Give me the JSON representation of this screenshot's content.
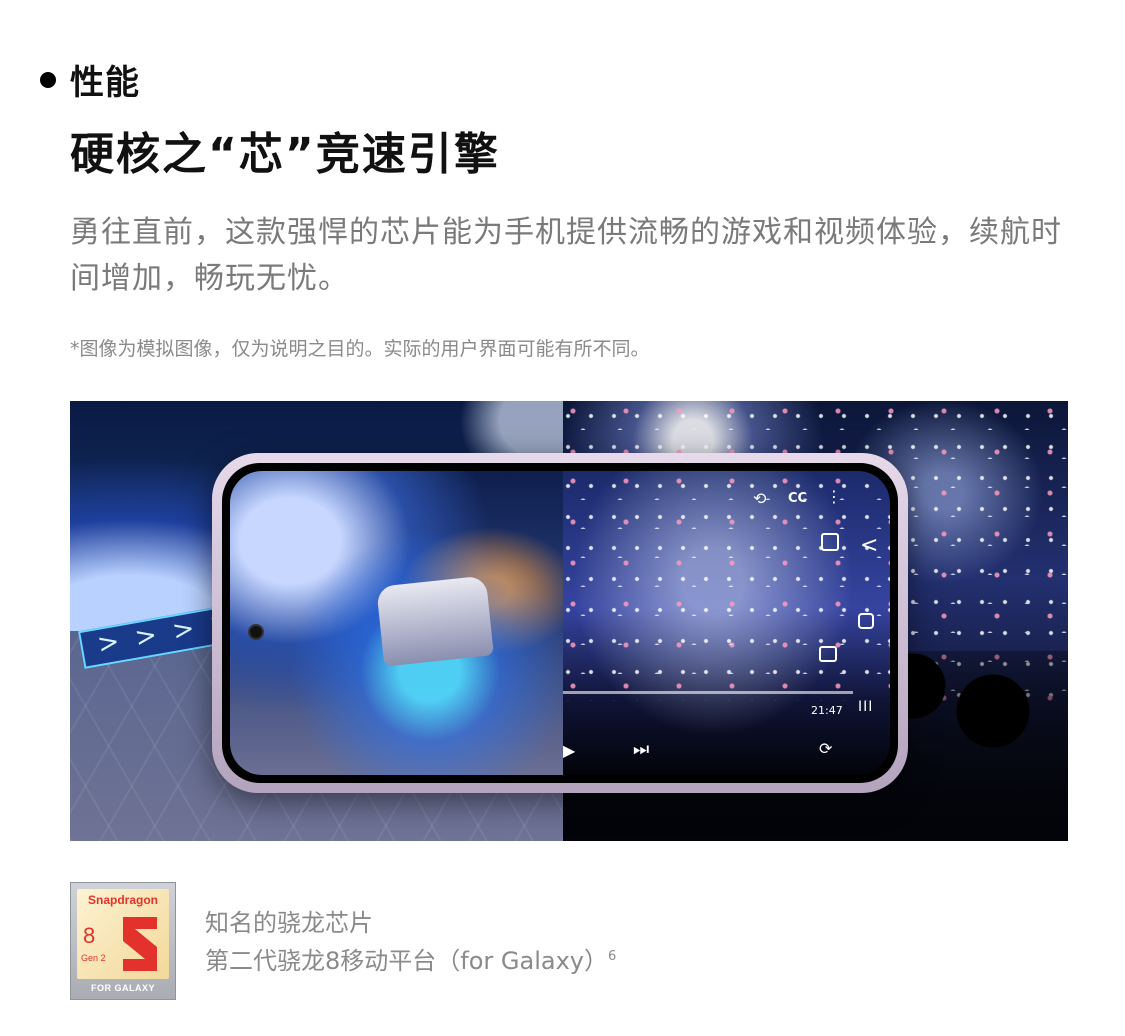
{
  "section": {
    "label": "性能"
  },
  "headline": "硬核之“芯”竞速引擎",
  "body": "勇往直前，这款强悍的芯片能为手机提供流畅的游戏和视频体验，续航时间增加，畅玩无忧。",
  "disclaimer": "*图像为模拟图像，仅为说明之目的。实际的用户界面可能有所不同。",
  "hero": {
    "left_scene": "racing-game",
    "right_scene": "concert-video",
    "game": {
      "track_chevrons": "> > > >"
    },
    "video": {
      "time": "21:47",
      "cc_label": "CC",
      "icons": [
        "rotate-icon",
        "cc-icon",
        "more-vert-icon",
        "pip-icon",
        "screenshot-icon",
        "play-icon",
        "fast-forward-icon",
        "rotate-lock-icon"
      ]
    },
    "navbar": {
      "back": "<",
      "recent": "III"
    }
  },
  "chip": {
    "badge": {
      "brand": "Snapdragon",
      "number": "8",
      "gen": "Gen 2",
      "footer": "FOR GALAXY"
    },
    "title": "知名的骁龙芯片",
    "subtitle": "第二代骁龙8移动平台（for Galaxy）",
    "footnote": "6",
    "colors": {
      "brand_red": "#e3322b",
      "badge_gold": "#f2d89a"
    }
  }
}
